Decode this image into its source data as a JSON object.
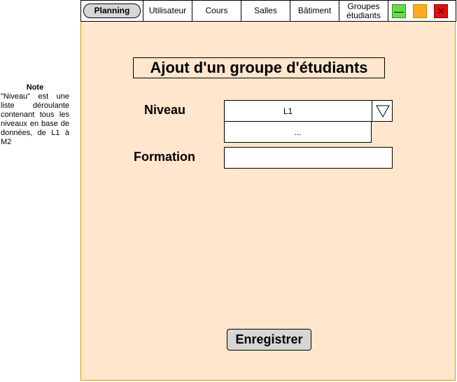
{
  "note": {
    "title": "Note",
    "text": "\"Niveau\" est une liste déroulante contenant tous les niveaux en base de données, de L1 à M2"
  },
  "topbar": {
    "tabs": {
      "planning": "Planning",
      "utilisateur": "Utilisateur",
      "cours": "Cours",
      "salles": "Salles",
      "batiment": "Bâtiment",
      "groupes_line1": "Groupes",
      "groupes_line2": "étudiants"
    },
    "window_buttons": {
      "minimize": "—",
      "close": "✕"
    }
  },
  "form": {
    "title": "Ajout d'un groupe d'étudiants",
    "niveau_label": "Niveau",
    "niveau_value": "L1",
    "niveau_option": "...",
    "formation_label": "Formation",
    "formation_value": "",
    "save_label": "Enregistrer"
  },
  "colors": {
    "window_bg": "#ffe6cc",
    "window_border": "#d79b00",
    "button_bg": "#d6d6d6",
    "minimize": "#66dd44",
    "maximize": "#ffaa22",
    "close": "#e01010"
  },
  "icons": {
    "dropdown": "triangle-down-icon",
    "minimize": "minimize-icon",
    "maximize": "maximize-icon",
    "close": "close-icon"
  }
}
